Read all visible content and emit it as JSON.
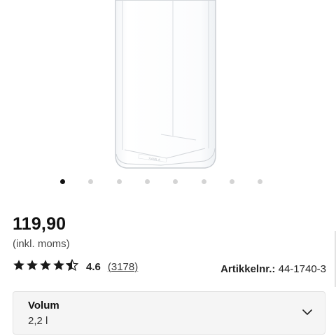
{
  "gallery": {
    "image": "clear-plastic-storage-container",
    "image_count": 8,
    "active_index": 0
  },
  "product": {
    "price": "119,90",
    "price_note": "(inkl. moms)",
    "rating": {
      "stars": 4.5,
      "max_stars": 5,
      "value": "4.6",
      "count": "(3178)"
    },
    "article_label": "Artikkelnr.:",
    "article_number": "44-1740-3"
  },
  "volume": {
    "label": "Volum",
    "selected": "2,2 l"
  },
  "colors": {
    "dot_active": "#111111",
    "dot_inactive": "#d4d4d4",
    "star": "#1a1a1a",
    "select_bg": "#f5f5f5"
  }
}
